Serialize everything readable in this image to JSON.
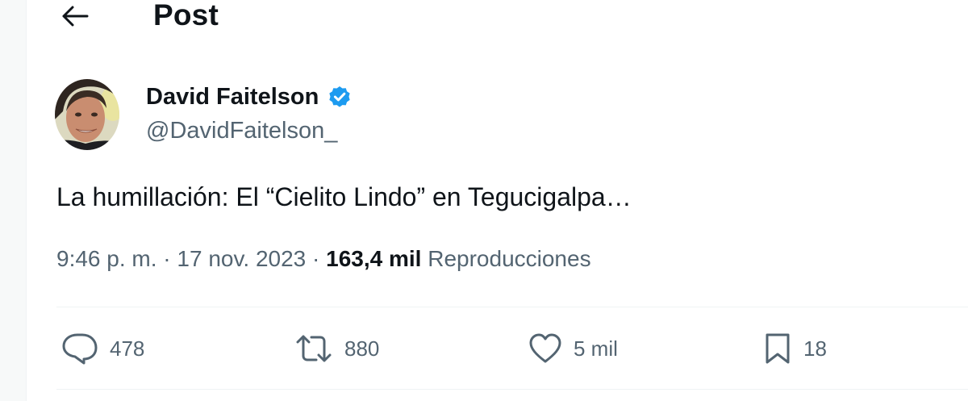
{
  "header": {
    "title": "Post",
    "back_icon": "arrow-left-icon"
  },
  "author": {
    "display_name": "David Faitelson",
    "handle": "@DavidFaitelson_",
    "verified": true,
    "verified_color": "#1d9bf0"
  },
  "tweet": {
    "text": "La humillación: El “Cielito Lindo” en Tegucigalpa…",
    "time": "9:46 p. m.",
    "separator": "·",
    "date": "17 nov. 2023",
    "views_count": "163,4 mil",
    "views_label": "Reproducciones"
  },
  "actions": {
    "replies": {
      "icon": "reply-icon",
      "count": "478"
    },
    "reposts": {
      "icon": "repost-icon",
      "count": "880"
    },
    "likes": {
      "icon": "heart-icon",
      "count": "5 mil"
    },
    "bookmarks": {
      "icon": "bookmark-icon",
      "count": "18"
    }
  },
  "colors": {
    "text_primary": "#0f1419",
    "text_secondary": "#536471",
    "divider": "#eff3f4"
  }
}
